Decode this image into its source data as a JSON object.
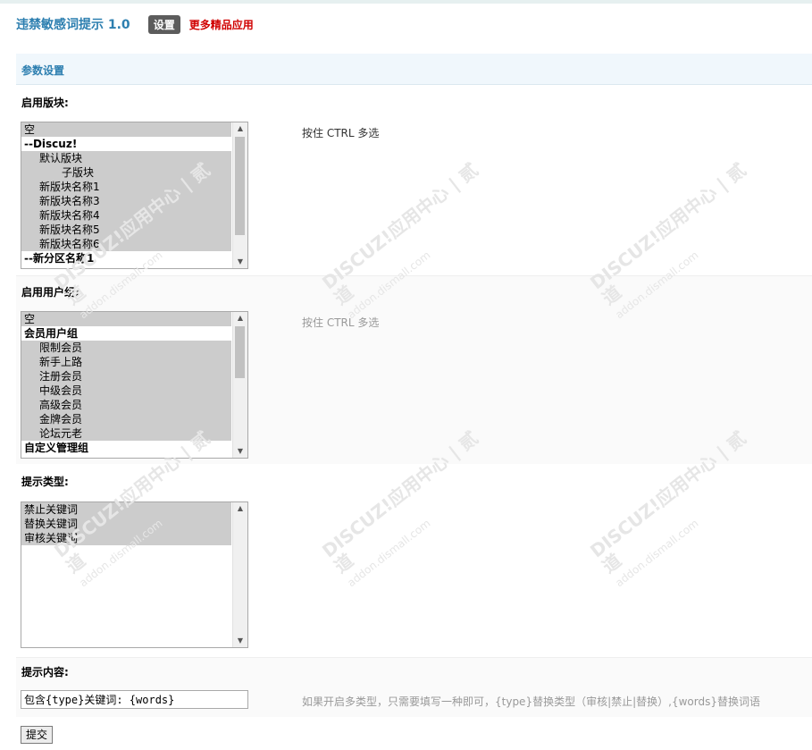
{
  "header": {
    "title": "违禁敏感词提示 1.0",
    "settings_label": "设置",
    "more_apps_label": "更多精品应用"
  },
  "section": {
    "title": "参数设置"
  },
  "forums": {
    "label": "启用版块:",
    "hint": "按住 CTRL 多选",
    "options": [
      {
        "text": "空",
        "selected": true,
        "group": false,
        "indent": 0
      },
      {
        "text": "--Discuz!",
        "selected": false,
        "group": true,
        "indent": 0
      },
      {
        "text": "默认版块",
        "selected": true,
        "group": false,
        "indent": 1
      },
      {
        "text": "子版块",
        "selected": true,
        "group": false,
        "indent": 2
      },
      {
        "text": "新版块名称1",
        "selected": true,
        "group": false,
        "indent": 1
      },
      {
        "text": "新版块名称3",
        "selected": true,
        "group": false,
        "indent": 1
      },
      {
        "text": "新版块名称4",
        "selected": true,
        "group": false,
        "indent": 1
      },
      {
        "text": "新版块名称5",
        "selected": true,
        "group": false,
        "indent": 1
      },
      {
        "text": "新版块名称6",
        "selected": true,
        "group": false,
        "indent": 1
      },
      {
        "text": "--新分区名称1",
        "selected": false,
        "group": true,
        "indent": 0
      }
    ]
  },
  "usergroups": {
    "label": "启用用户组:",
    "hint": "按住 CTRL 多选",
    "options": [
      {
        "text": "空",
        "selected": true,
        "group": false,
        "indent": 0
      },
      {
        "text": "会员用户组",
        "selected": false,
        "group": true,
        "indent": 0
      },
      {
        "text": "限制会员",
        "selected": true,
        "group": false,
        "indent": 1
      },
      {
        "text": "新手上路",
        "selected": true,
        "group": false,
        "indent": 1
      },
      {
        "text": "注册会员",
        "selected": true,
        "group": false,
        "indent": 1
      },
      {
        "text": "中级会员",
        "selected": true,
        "group": false,
        "indent": 1
      },
      {
        "text": "高级会员",
        "selected": true,
        "group": false,
        "indent": 1
      },
      {
        "text": "金牌会员",
        "selected": true,
        "group": false,
        "indent": 1
      },
      {
        "text": "论坛元老",
        "selected": true,
        "group": false,
        "indent": 1
      },
      {
        "text": "自定义管理组",
        "selected": false,
        "group": true,
        "indent": 0
      }
    ]
  },
  "types": {
    "label": "提示类型:",
    "options": [
      {
        "text": "禁止关键词",
        "selected": true,
        "group": false,
        "indent": 0
      },
      {
        "text": "替换关键词",
        "selected": true,
        "group": false,
        "indent": 0
      },
      {
        "text": "审核关键词",
        "selected": true,
        "group": false,
        "indent": 0
      }
    ]
  },
  "content": {
    "label": "提示内容:",
    "value": "包含{type}关键词: {words}",
    "hint": "如果开启多类型，只需要填写一种即可，{type}替换类型（审核|禁止|替换）,{words}替换词语"
  },
  "submit_label": "提交",
  "watermark": {
    "brand": "DISCUZ!应用中心 | 贰道",
    "domain": "addon.dismall.com"
  },
  "colors": {
    "accent": "#2d7fb0",
    "link_red": "#d00000",
    "selected_bg": "#cccccc"
  }
}
